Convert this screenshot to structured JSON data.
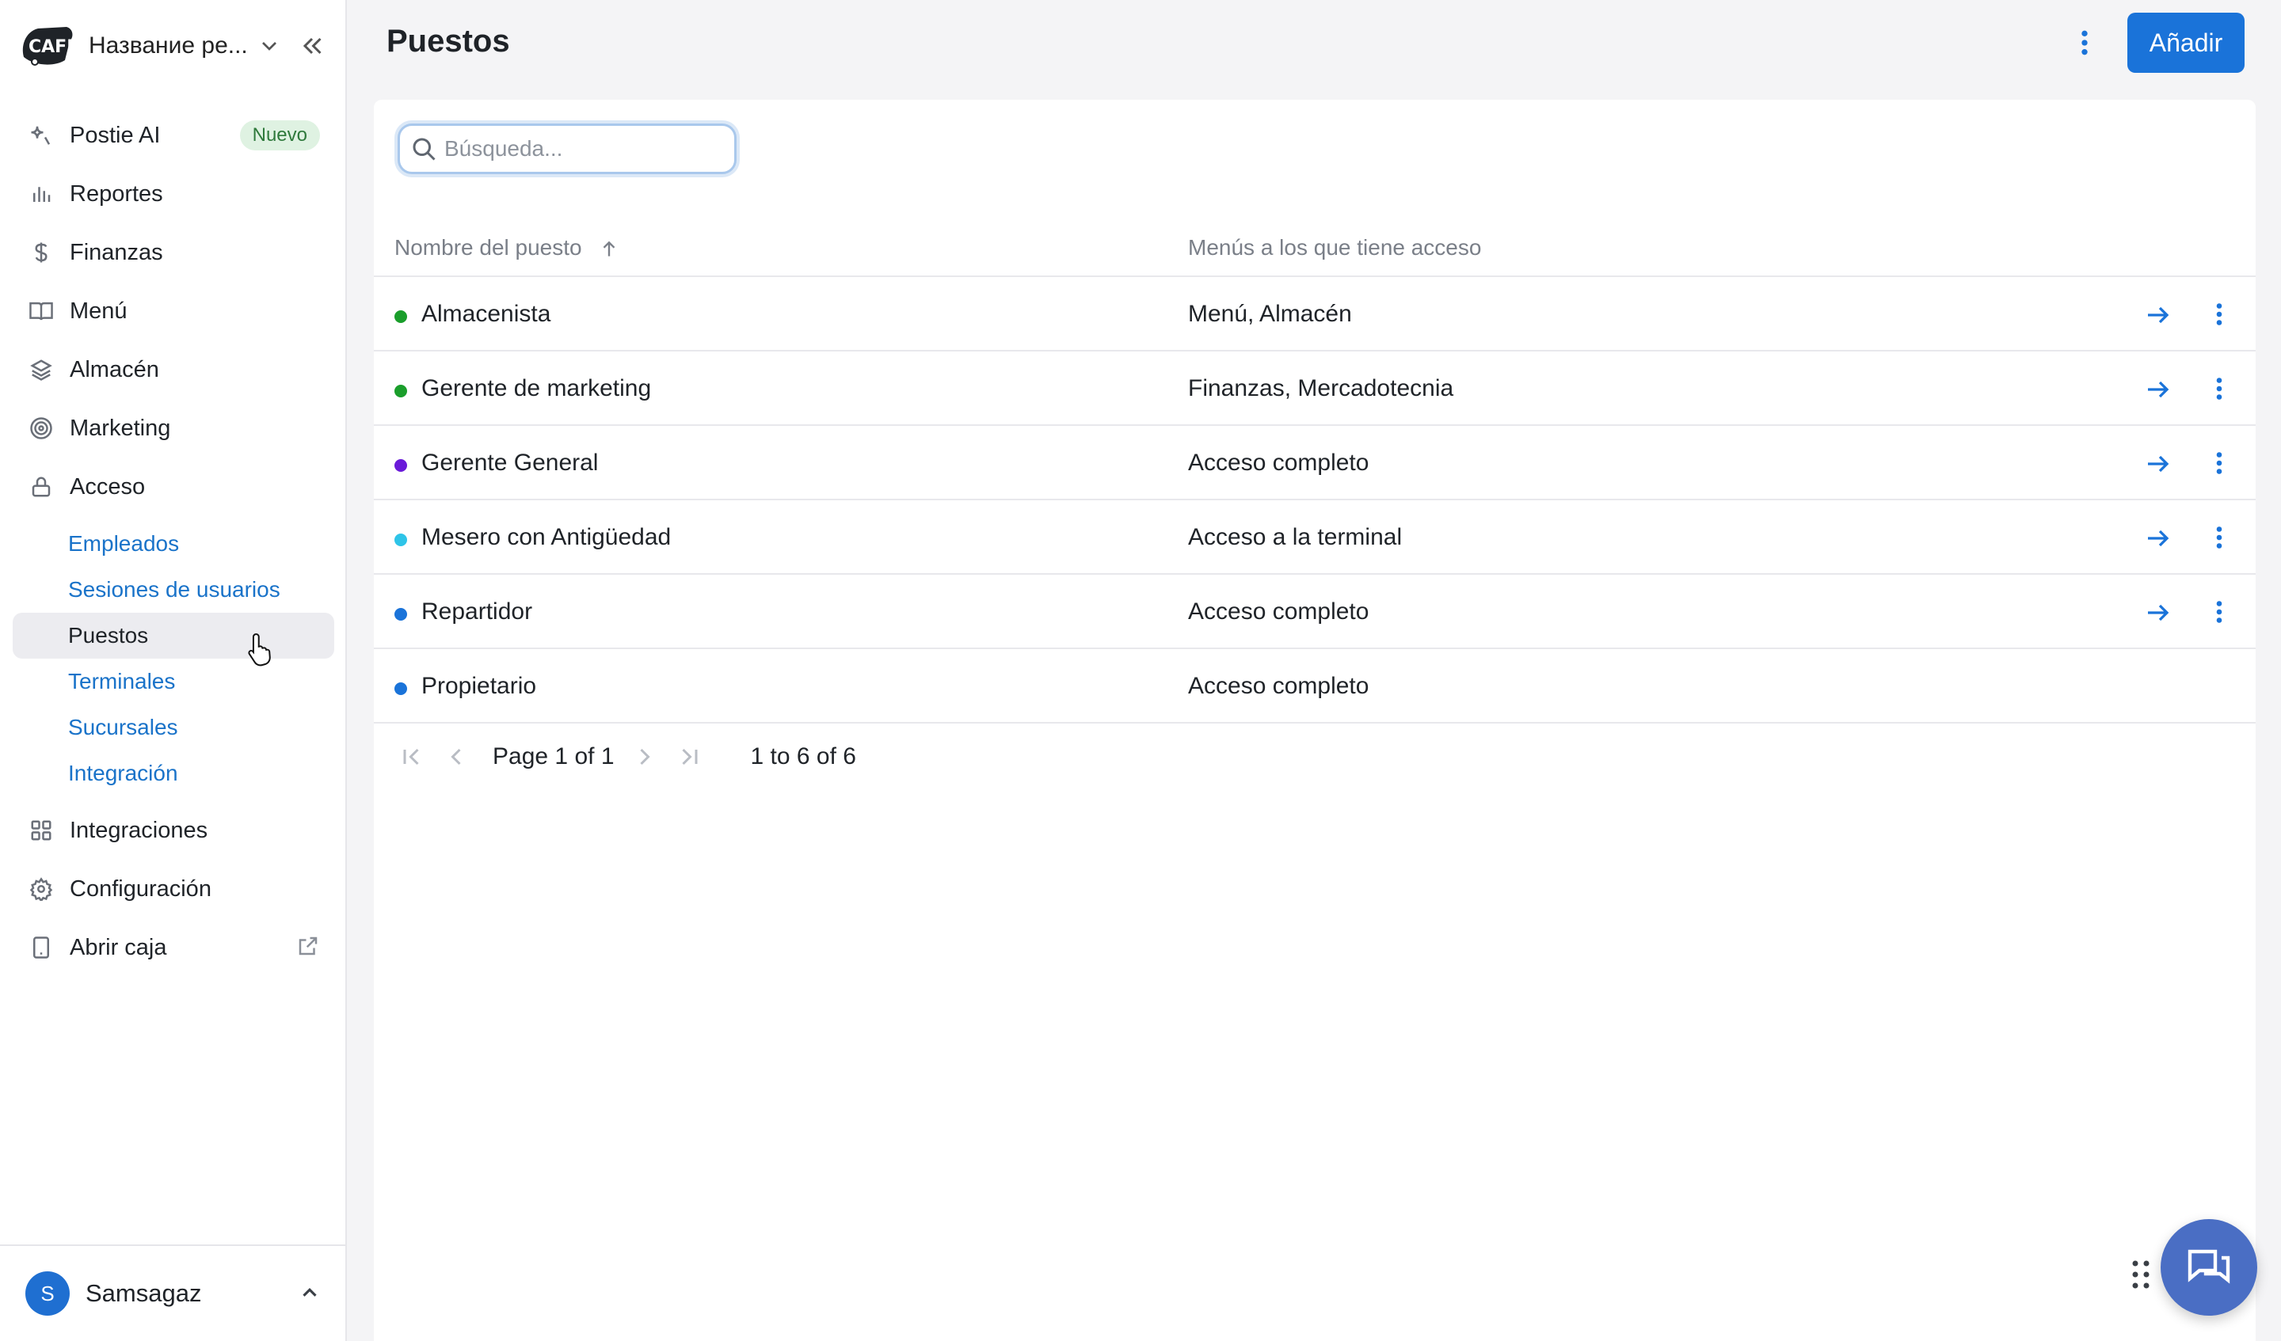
{
  "brand": {
    "name": "Название ре...",
    "logo_icon": "cafe-logo-icon"
  },
  "sidebar": {
    "items": [
      {
        "label": "Postie AI",
        "icon": "sparkle-icon",
        "badge": "Nuevo"
      },
      {
        "label": "Reportes",
        "icon": "bar-chart-icon"
      },
      {
        "label": "Finanzas",
        "icon": "dollar-icon"
      },
      {
        "label": "Menú",
        "icon": "book-icon"
      },
      {
        "label": "Almacén",
        "icon": "layers-icon"
      },
      {
        "label": "Marketing",
        "icon": "target-icon"
      },
      {
        "label": "Acceso",
        "icon": "lock-icon"
      }
    ],
    "access_sub": [
      "Empleados",
      "Sesiones de usuarios",
      "Puestos",
      "Terminales",
      "Sucursales",
      "Integración"
    ],
    "active_sub": "Puestos",
    "bottom_items": [
      {
        "label": "Integraciones",
        "icon": "grid-icon"
      },
      {
        "label": "Configuración",
        "icon": "gear-icon"
      },
      {
        "label": "Abrir caja",
        "icon": "tablet-icon"
      }
    ]
  },
  "user": {
    "initial": "S",
    "name": "Samsagaz"
  },
  "main": {
    "title": "Puestos",
    "add_label": "Añadir"
  },
  "search": {
    "placeholder": "Búsqueda..."
  },
  "table": {
    "columns": [
      "Nombre del puesto",
      "Menús a los que tiene acceso"
    ],
    "rows": [
      {
        "name": "Almacenista",
        "menus": "Menú, Almacén",
        "dot": "#1a9e2b",
        "actions": true
      },
      {
        "name": "Gerente de marketing",
        "menus": "Finanzas, Mercadotecnia",
        "dot": "#1a9e2b",
        "actions": true
      },
      {
        "name": "Gerente General",
        "menus": "Acceso completo",
        "dot": "#6a1ad9",
        "actions": true
      },
      {
        "name": "Mesero con Antigüedad",
        "menus": "Acceso a la terminal",
        "dot": "#2ec4e8",
        "actions": true
      },
      {
        "name": "Repartidor",
        "menus": "Acceso completo",
        "dot": "#1a73d9",
        "actions": true
      },
      {
        "name": "Propietario",
        "menus": "Acceso completo",
        "dot": "#1a73d9",
        "actions": false
      }
    ]
  },
  "pagination": {
    "page_label": "Page",
    "page": "1",
    "of_label": "of",
    "total_pages": "1",
    "range": "1 to 6 of 6"
  },
  "colors": {
    "accent": "#1a73d9",
    "chat": "#4a6ec4"
  }
}
